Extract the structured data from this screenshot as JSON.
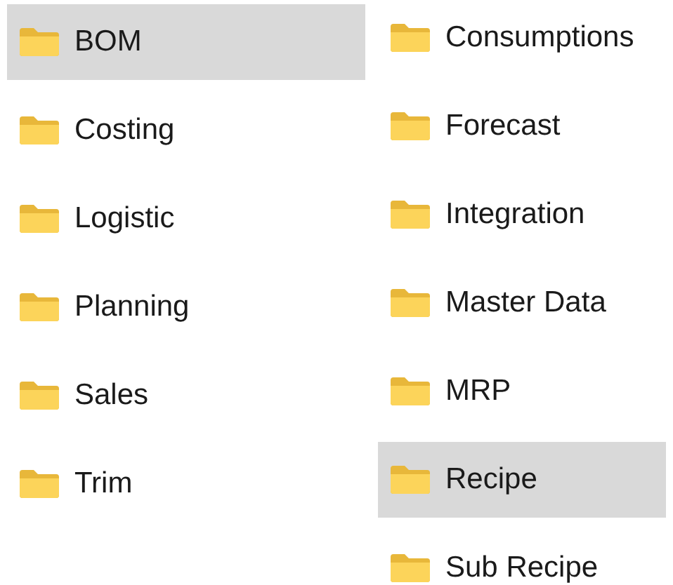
{
  "columns": [
    {
      "items": [
        {
          "label": "BOM",
          "selected": true
        },
        {
          "label": "Costing",
          "selected": false
        },
        {
          "label": "Logistic",
          "selected": false
        },
        {
          "label": "Planning",
          "selected": false
        },
        {
          "label": "Sales",
          "selected": false
        },
        {
          "label": "Trim",
          "selected": false
        }
      ]
    },
    {
      "items": [
        {
          "label": "Consumptions",
          "selected": false
        },
        {
          "label": "Forecast",
          "selected": false
        },
        {
          "label": "Integration",
          "selected": false
        },
        {
          "label": "Master Data",
          "selected": false
        },
        {
          "label": "MRP",
          "selected": false
        },
        {
          "label": "Recipe",
          "selected": true
        },
        {
          "label": "Sub Recipe",
          "selected": false
        }
      ]
    }
  ]
}
